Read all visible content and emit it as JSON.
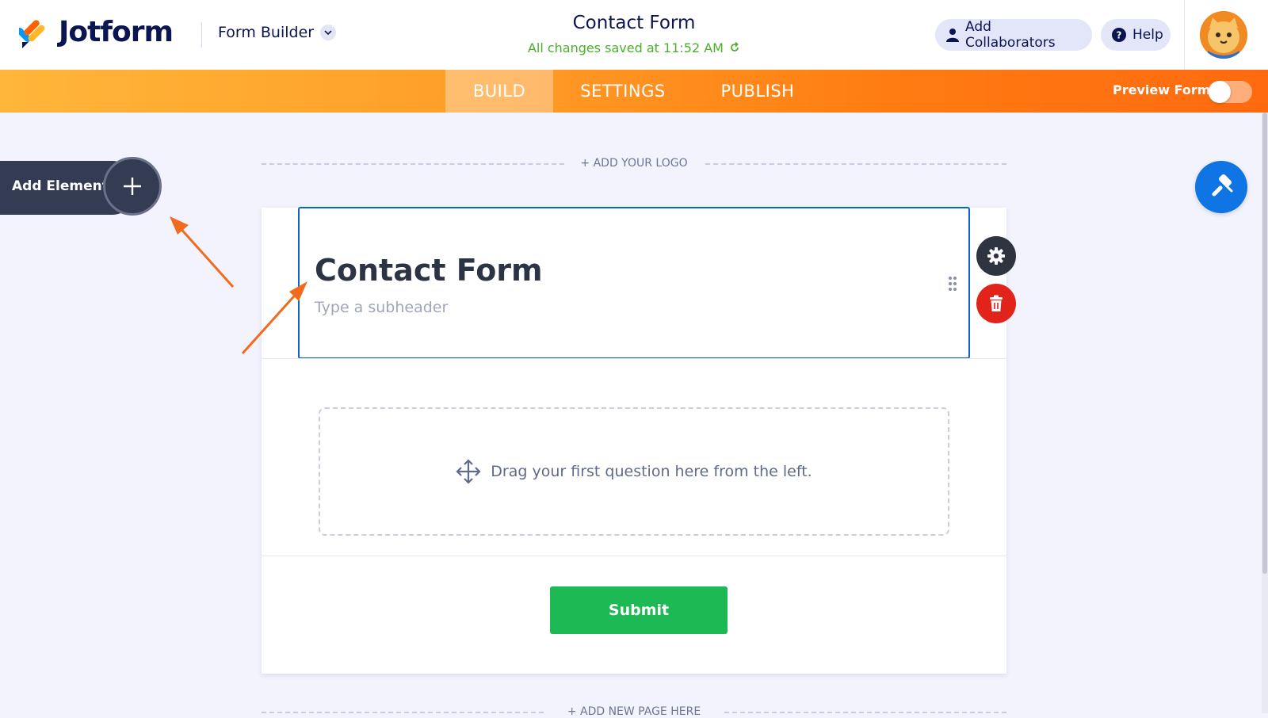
{
  "header": {
    "logo_text": "Jotform",
    "builder_label": "Form Builder",
    "form_title": "Contact Form",
    "saved_status": "All changes saved at 11:52 AM",
    "collaborators_label": "Add Collaborators",
    "help_label": "Help"
  },
  "nav": {
    "tabs": [
      {
        "label": "BUILD",
        "active": true
      },
      {
        "label": "SETTINGS",
        "active": false
      },
      {
        "label": "PUBLISH",
        "active": false
      }
    ],
    "preview_label": "Preview Form",
    "preview_enabled": false
  },
  "sidebar": {
    "add_element_label": "Add Element"
  },
  "form": {
    "add_logo_label": "+ ADD YOUR LOGO",
    "title": "Contact Form",
    "subheader_placeholder": "Type a subheader",
    "dropzone_text": "Drag your first question here from the left.",
    "submit_label": "Submit",
    "add_page_label": "+ ADD NEW PAGE HERE"
  },
  "colors": {
    "accent_orange": "#ff7c12",
    "selection_blue": "#0d63c9",
    "submit_green": "#1db954",
    "delete_red": "#e2231a",
    "annotation_arrow": "#f26a1b"
  },
  "icons": [
    "jotform-logo-icon",
    "chevron-down-icon",
    "user-icon",
    "question-icon",
    "refresh-icon",
    "avatar",
    "plus-icon",
    "gear-icon",
    "trash-icon",
    "drag-grip-icon",
    "move-icon",
    "paint-roller-icon"
  ]
}
